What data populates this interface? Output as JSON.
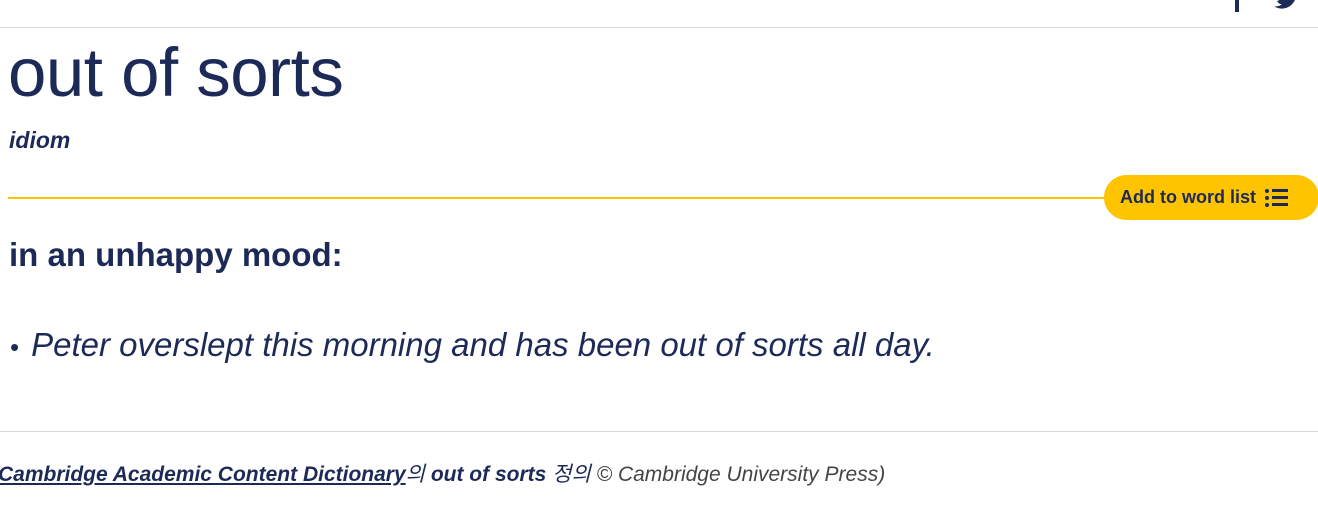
{
  "entry": {
    "headword": "out of sorts",
    "part_of_speech": "idiom",
    "definition": "in an unhappy mood:",
    "example_bullet": "•",
    "example": "Peter overslept this morning and has been out of sorts all day."
  },
  "actions": {
    "add_to_word_list": "Add to word list",
    "icons": [
      "facebook-icon",
      "twitter-icon",
      "list-icon"
    ]
  },
  "source_line": {
    "dictionary_link": "Cambridge Academic Content Dictionary",
    "particle": "의",
    "term": "out of sorts",
    "suffix": "정의",
    "copyright": "© Cambridge University Press)"
  },
  "colors": {
    "text": "#1d2a57",
    "accent": "#fec400",
    "rule": "#d9d9d9"
  }
}
